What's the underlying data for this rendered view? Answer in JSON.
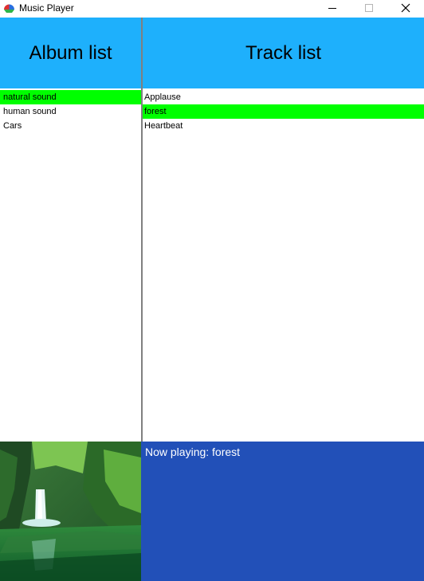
{
  "window": {
    "title": "Music Player",
    "icon": "music-player-app-icon",
    "controls": [
      "minimize-icon",
      "maximize-icon",
      "close-icon"
    ]
  },
  "headers": {
    "album_list": "Album list",
    "track_list": "Track list"
  },
  "albums": [
    {
      "label": "natural sound",
      "selected": true
    },
    {
      "label": "human sound",
      "selected": false
    },
    {
      "label": "Cars",
      "selected": false
    }
  ],
  "tracks": [
    {
      "label": "Applause",
      "selected": false
    },
    {
      "label": "forest",
      "selected": true
    },
    {
      "label": "Heartbeat",
      "selected": false
    }
  ],
  "now_playing": {
    "text": "Now playing: forest"
  },
  "colors": {
    "header_bg": "#1eb0fc",
    "selection": "#00ff00",
    "now_playing_bg": "#2250b8"
  }
}
